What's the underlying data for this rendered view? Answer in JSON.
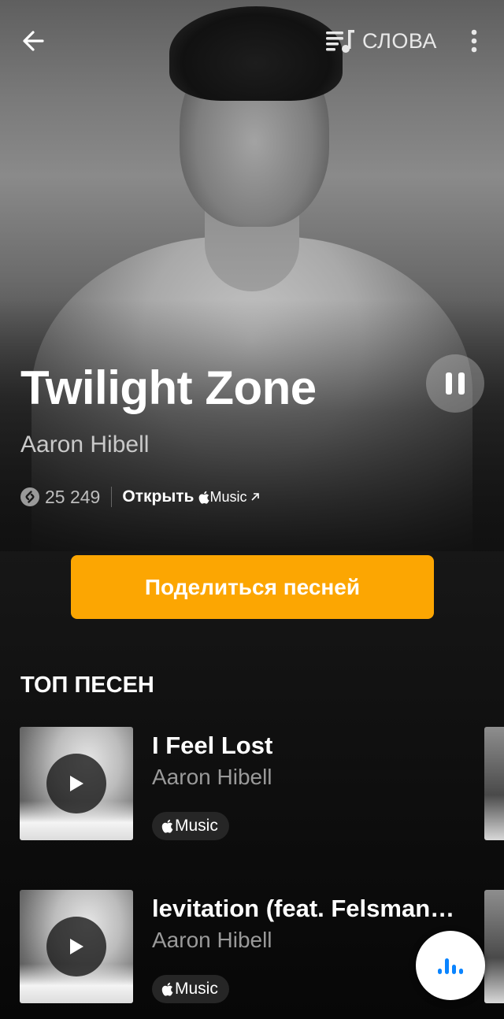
{
  "header": {
    "back_icon": "arrow-left-icon",
    "lyrics_label": "СЛОВА",
    "lyrics_icon": "lyrics-icon",
    "more_icon": "more-vertical-icon"
  },
  "song": {
    "title": "Twilight Zone",
    "artist": "Aaron Hibell",
    "shazam_count": "25 249",
    "open_label": "Открыть",
    "apple_music_label": "Music",
    "playing": true
  },
  "share": {
    "label": "Поделиться песней"
  },
  "top_songs": {
    "section_title": "ТОП ПЕСЕН",
    "items": [
      {
        "title": "I Feel Lost",
        "artist": "Aaron Hibell",
        "badge": "Music"
      },
      {
        "title": "levitation (feat. Felsmann + Tiley)",
        "artist": "Aaron Hibell",
        "badge": "Music"
      }
    ]
  },
  "colors": {
    "accent": "#fca602",
    "fab_icon": "#0a84ff",
    "background": "#0c0c0c"
  }
}
